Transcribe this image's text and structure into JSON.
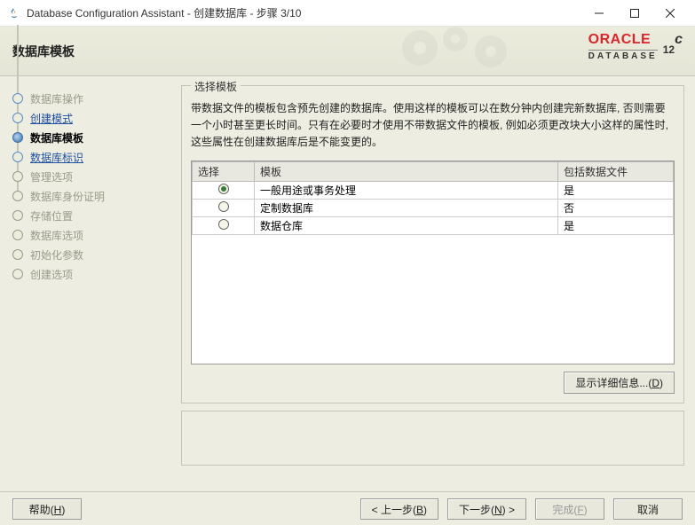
{
  "window": {
    "title": "Database Configuration Assistant - 创建数据库 - 步骤 3/10"
  },
  "header": {
    "page_title": "数据库模板",
    "brand": "ORACLE",
    "brand_sub": "DATABASE",
    "version_main": "12",
    "version_sup": "c"
  },
  "sidebar": {
    "items": [
      {
        "label": "数据库操作",
        "state": "done-dim"
      },
      {
        "label": "创建模式",
        "state": "done-link"
      },
      {
        "label": "数据库模板",
        "state": "active"
      },
      {
        "label": "数据库标识",
        "state": "next-link"
      },
      {
        "label": "管理选项",
        "state": "future"
      },
      {
        "label": "数据库身份证明",
        "state": "future"
      },
      {
        "label": "存储位置",
        "state": "future"
      },
      {
        "label": "数据库选项",
        "state": "future"
      },
      {
        "label": "初始化参数",
        "state": "future"
      },
      {
        "label": "创建选项",
        "state": "future"
      }
    ]
  },
  "panel": {
    "title": "选择模板",
    "description": "带数据文件的模板包含预先创建的数据库。使用这样的模板可以在数分钟内创建完新数据库, 否则需要一个小时甚至更长时间。只有在必要时才使用不带数据文件的模板, 例如必须更改块大小这样的属性时, 这些属性在创建数据库后是不能变更的。",
    "columns": {
      "select": "选择",
      "template": "模板",
      "include": "包括数据文件"
    },
    "rows": [
      {
        "selected": true,
        "template": "一般用途或事务处理",
        "include": "是"
      },
      {
        "selected": false,
        "template": "定制数据库",
        "include": "否"
      },
      {
        "selected": false,
        "template": "数据仓库",
        "include": "是"
      }
    ],
    "detail_button": "显示详细信息...",
    "detail_mn": "D"
  },
  "footer": {
    "help": "帮助",
    "help_mn": "H",
    "back": "< 上一步",
    "back_mn": "B",
    "next": "下一步",
    "next_mn": "N",
    "next_suffix": " >",
    "finish": "完成",
    "finish_mn": "F",
    "cancel": "取消"
  }
}
